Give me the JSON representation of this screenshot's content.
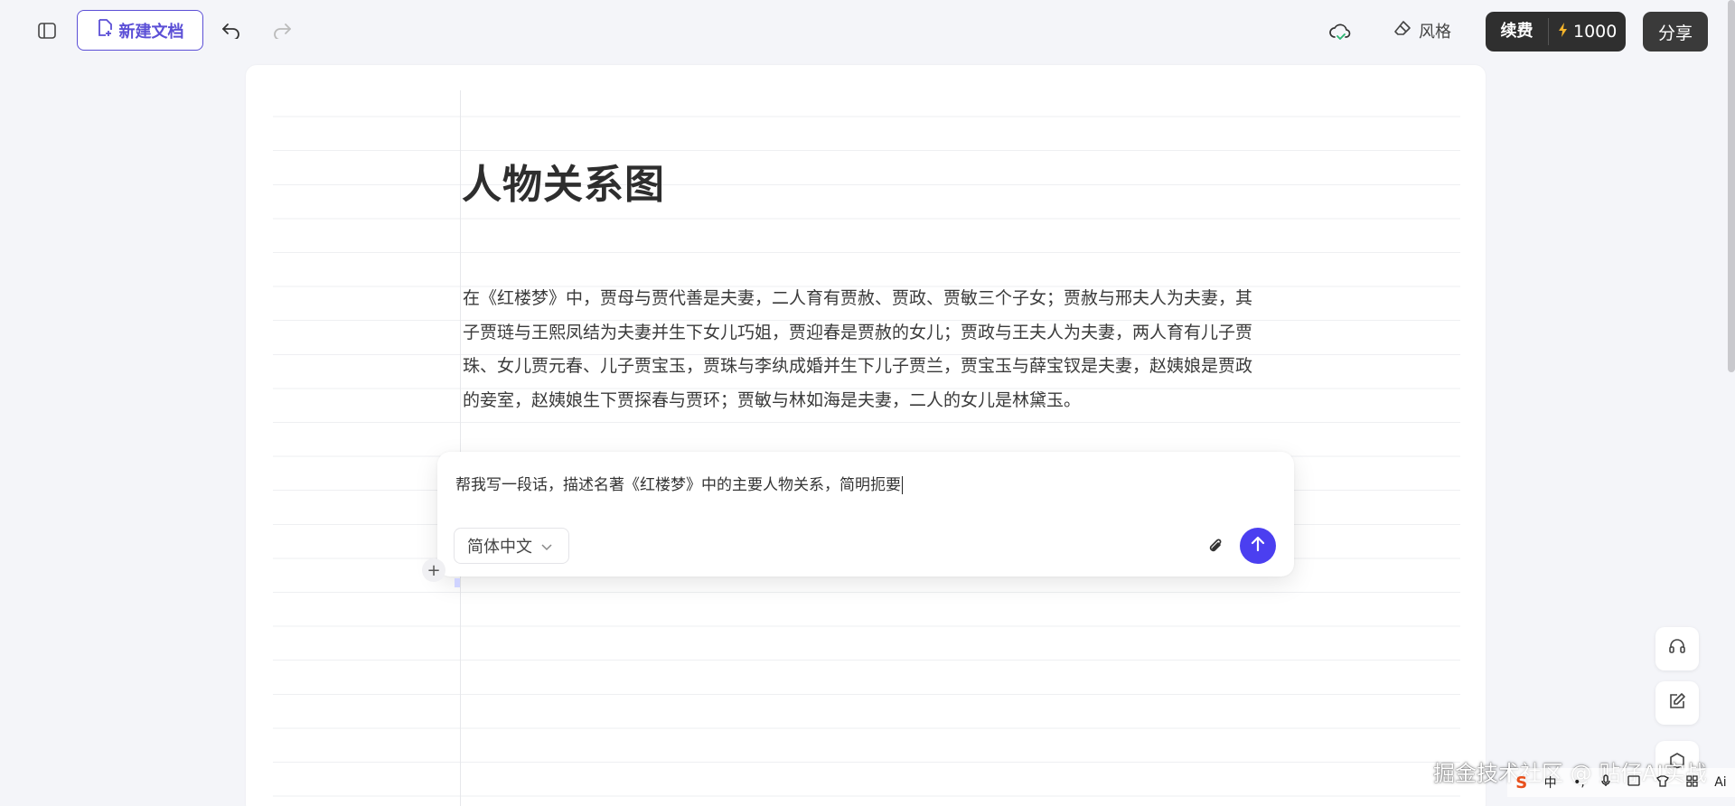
{
  "toolbar": {
    "new_doc_label": "新建文档",
    "style_label": "风格",
    "renew_label": "续费",
    "credits": "1000",
    "share_label": "分享"
  },
  "document": {
    "title": "人物关系图",
    "paragraph": "在《红楼梦》中，贾母与贾代善是夫妻，二人育有贾赦、贾政、贾敏三个子女；贾赦与邢夫人为夫妻，其子贾琏与王熙凤结为夫妻并生下女儿巧姐，贾迎春是贾赦的女儿；贾政与王夫人为夫妻，两人育有儿子贾珠、女儿贾元春、儿子贾宝玉，贾珠与李纨成婚并生下儿子贾兰，贾宝玉与薛宝钗是夫妻，赵姨娘是贾政的妾室，赵姨娘生下贾探春与贾环；贾敏与林如海是夫妻，二人的女儿是林黛玉。"
  },
  "prompt": {
    "text": "帮我写一段话，描述名著《红楼梦》中的主要人物关系，简明扼要",
    "language": "简体中文"
  },
  "watermark": "掘金技术社区 @ 贴仔AI实战",
  "ime": {
    "logo": "S",
    "mode": "中",
    "ai_label": "Ai"
  },
  "colors": {
    "accent": "#5b4fd6",
    "send": "#4b3ff0",
    "dark_button": "#2f2f2f"
  },
  "icons": [
    "sidebar-toggle-icon",
    "new-doc-icon",
    "undo-icon",
    "redo-icon",
    "cloud-sync-icon",
    "style-brush-icon",
    "lightning-icon",
    "chevron-down-icon",
    "attach-icon",
    "send-arrow-icon",
    "headset-icon",
    "edit-icon",
    "cube-icon"
  ]
}
